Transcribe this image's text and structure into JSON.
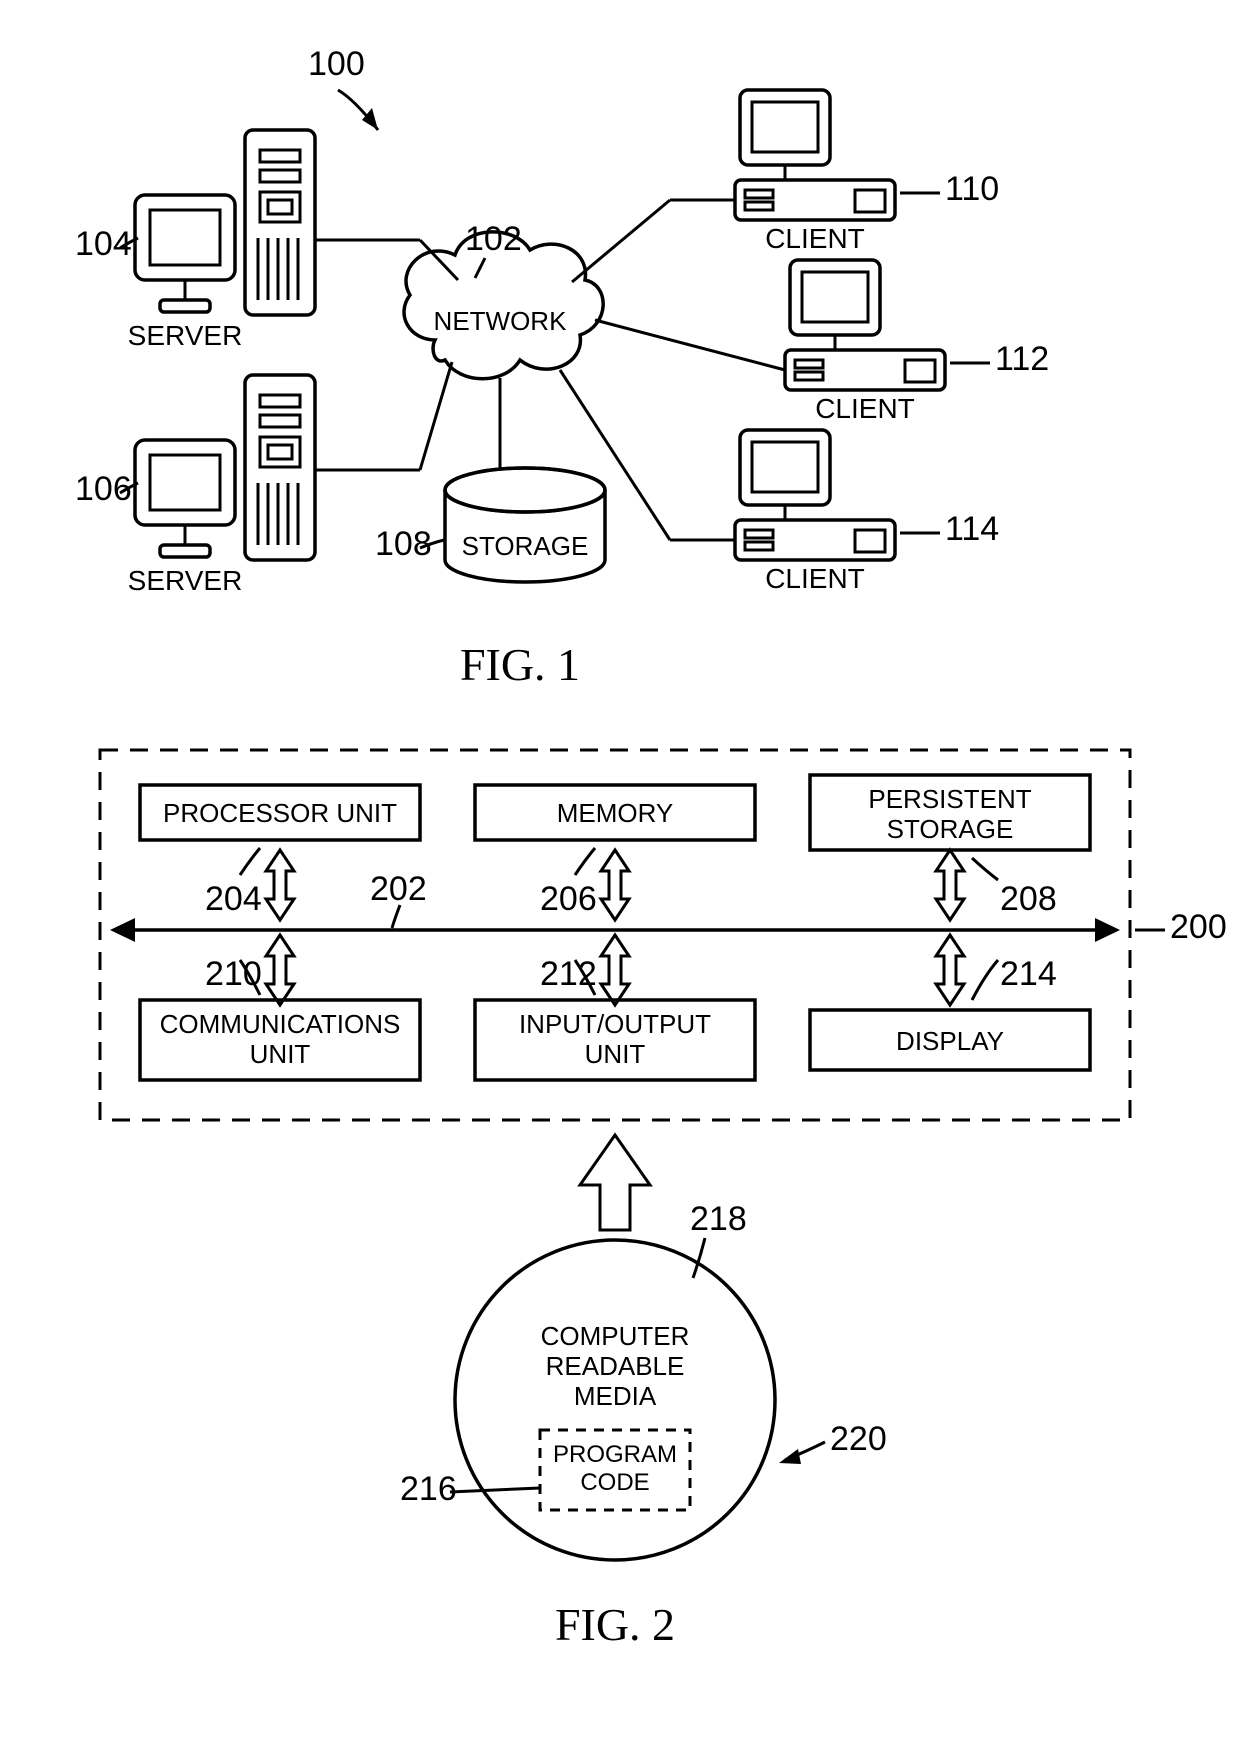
{
  "fig1": {
    "caption": "FIG. 1",
    "labels": {
      "ref100": "100",
      "ref102": "102",
      "ref104": "104",
      "ref106": "106",
      "ref108": "108",
      "ref110": "110",
      "ref112": "112",
      "ref114": "114",
      "network": "NETWORK",
      "storage": "STORAGE",
      "server1": "SERVER",
      "server2": "SERVER",
      "client1": "CLIENT",
      "client2": "CLIENT",
      "client3": "CLIENT"
    }
  },
  "fig2": {
    "caption": "FIG. 2",
    "labels": {
      "processor": "PROCESSOR UNIT",
      "memory": "MEMORY",
      "persistentL1": "PERSISTENT",
      "persistentL2": "STORAGE",
      "comm1": "COMMUNICATIONS",
      "comm2": "UNIT",
      "io1": "INPUT/OUTPUT",
      "io2": "UNIT",
      "display": "DISPLAY",
      "media1": "COMPUTER",
      "media2": "READABLE",
      "media3": "MEDIA",
      "prog1": "PROGRAM",
      "prog2": "CODE",
      "ref200": "200",
      "ref202": "202",
      "ref204": "204",
      "ref206": "206",
      "ref208": "208",
      "ref210": "210",
      "ref212": "212",
      "ref214": "214",
      "ref216": "216",
      "ref218": "218",
      "ref220": "220"
    }
  }
}
